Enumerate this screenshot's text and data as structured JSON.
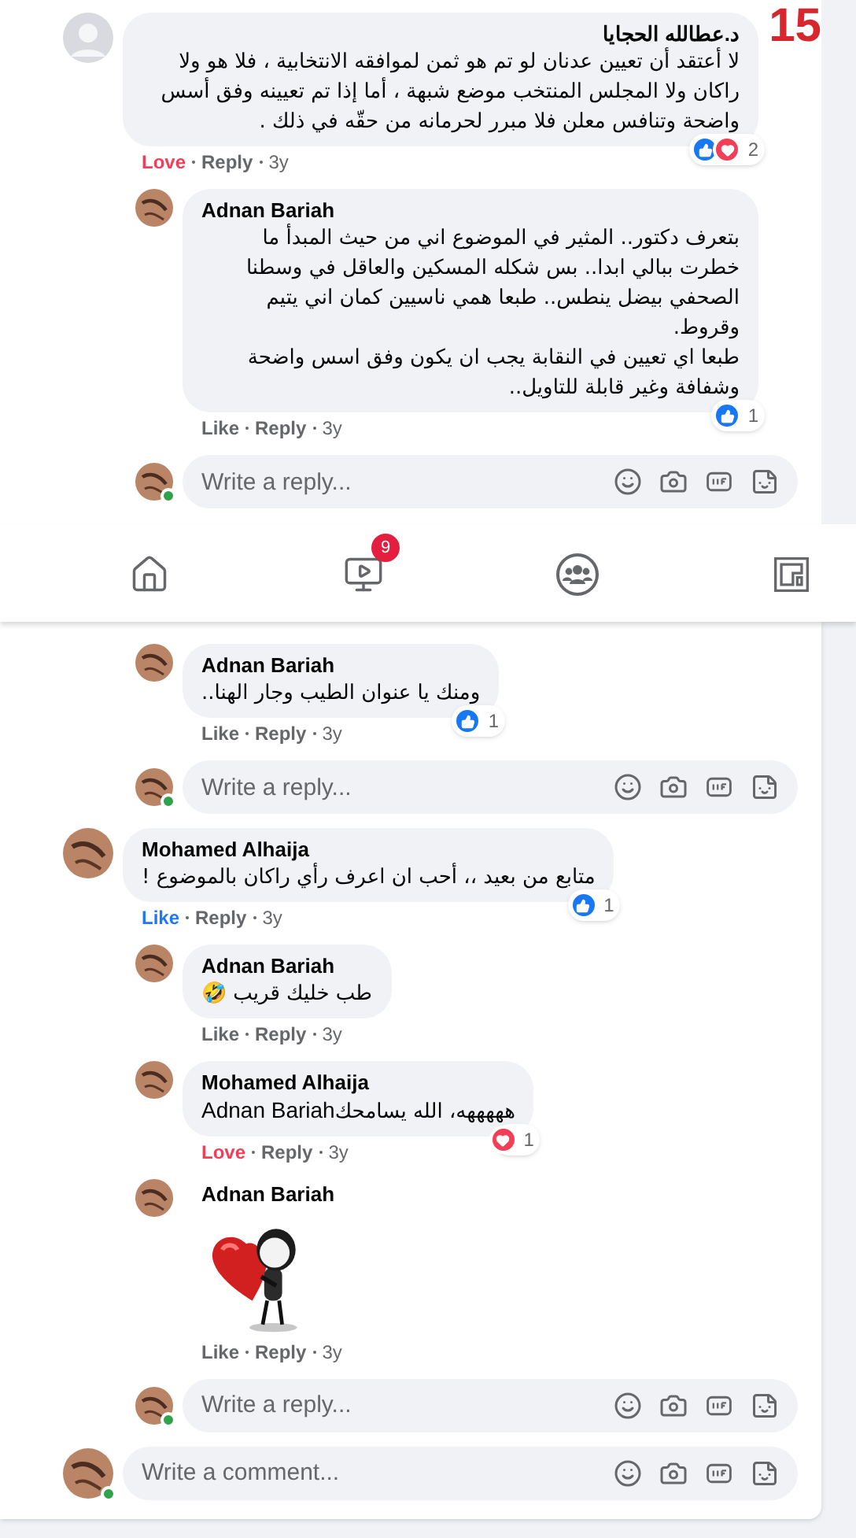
{
  "corner_number": "15",
  "segments": [
    {
      "kind": "thread",
      "items": [
        {
          "kind": "comment",
          "avatar": {
            "kind": "placeholder"
          },
          "author": "د.عطالله الحجايا",
          "text": "لا أعتقد أن تعيين عدنان لو تم هو ثمن لموافقه الانتخابية ، فلا هو ولا راكان ولا المجلس المنتخب موضع شبهة ، أما إذا تم تعيينه وفق أسس واضحة وتنافس معلن فلا مبرر لحرمانه من حقّه في ذلك .",
          "reactions": {
            "icons": [
              {
                "kind": "like"
              },
              {
                "kind": "love"
              }
            ],
            "count": "2"
          },
          "react": {
            "label": "Love",
            "kind": "love"
          },
          "reply_label": "Reply",
          "time": "3y"
        },
        {
          "kind": "reply",
          "author": "Adnan Bariah",
          "text": "بتعرف دكتور.. المثير في الموضوع اني من حيث المبدأ ما خطرت ببالي ابدا.. بس شكله المسكين والعاقل في وسطنا الصحفي بيضل ينطس.. طبعا همي ناسيين كمان اني يتيم وقروط.\nطبعا اي تعيين في النقابة يجب ان يكون وفق اسس واضحة وشفافة وغير قابلة للتاويل..",
          "reactions": {
            "icons": [
              {
                "kind": "like"
              }
            ],
            "count": "1"
          },
          "react": {
            "label": "Like",
            "kind": "none"
          },
          "reply_label": "Reply",
          "time": "3y"
        },
        {
          "kind": "reply_box",
          "placeholder": "Write a reply...",
          "online": true
        }
      ]
    },
    {
      "kind": "nav_bar",
      "tabs": [
        {
          "kind": "home"
        },
        {
          "kind": "video",
          "badge": "9"
        },
        {
          "kind": "groups"
        },
        {
          "kind": "gaming"
        }
      ]
    },
    {
      "kind": "thread",
      "items": [
        {
          "kind": "reply",
          "author": "Adnan Bariah",
          "text": "ومنك يا عنوان الطيب وجار الهنا..",
          "reactions": {
            "icons": [
              {
                "kind": "like"
              }
            ],
            "count": "1"
          },
          "react": {
            "label": "Like",
            "kind": "none"
          },
          "reply_label": "Reply",
          "time": "3y"
        },
        {
          "kind": "reply_box",
          "placeholder": "Write a reply...",
          "online": true
        },
        {
          "kind": "comment",
          "author": "Mohamed Alhaija",
          "text": "متابع من بعيد ،، أحب ان اعرف رأي راكان بالموضوع !",
          "reactions": {
            "icons": [
              {
                "kind": "like"
              }
            ],
            "count": "1"
          },
          "react": {
            "label": "Like",
            "kind": "like"
          },
          "reply_label": "Reply",
          "time": "3y"
        },
        {
          "kind": "reply",
          "author": "Adnan Bariah",
          "text": "طب خليك قريب 🤣",
          "react": {
            "label": "Like",
            "kind": "none"
          },
          "reply_label": "Reply",
          "time": "3y"
        },
        {
          "kind": "reply",
          "author": "Mohamed Alhaija",
          "text": "هههههه، الله يسامحك",
          "mention": "Adnan Bariah",
          "reactions": {
            "icons": [
              {
                "kind": "love"
              }
            ],
            "count": "1"
          },
          "react": {
            "label": "Love",
            "kind": "love"
          },
          "reply_label": "Reply",
          "time": "3y"
        },
        {
          "kind": "sticker_reply",
          "author": "Adnan Bariah",
          "react": {
            "label": "Like",
            "kind": "none"
          },
          "reply_label": "Reply",
          "time": "3y"
        },
        {
          "kind": "reply_box",
          "placeholder": "Write a reply...",
          "online": true
        },
        {
          "kind": "comment_box",
          "placeholder": "Write a comment...",
          "online": true
        }
      ]
    }
  ]
}
